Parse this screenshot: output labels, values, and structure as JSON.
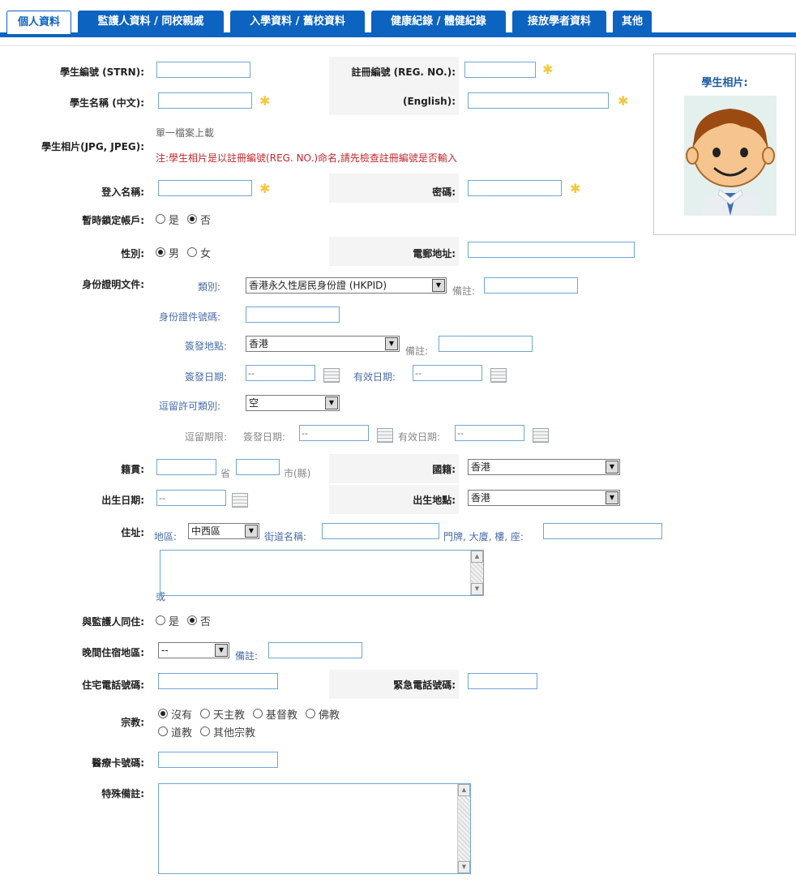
{
  "tabs": [
    {
      "label": "個人資料"
    },
    {
      "label": "監護人資料 / 同校親戚"
    },
    {
      "label": "入學資料 / 舊校資料"
    },
    {
      "label": "健康紀錄 / 體健紀錄"
    },
    {
      "label": "接放學者資料"
    },
    {
      "label": "其他"
    }
  ],
  "photo": {
    "title": "學生相片:"
  },
  "labels": {
    "strn": "學生編號 (STRN):",
    "reg_no": "註冊編號 (REG. NO.):",
    "name_zh": "學生名稱 (中文):",
    "name_en": "(English):",
    "photo_file": "學生相片(JPG, JPEG):",
    "login": "登入名稱:",
    "password": "密碼:",
    "lock": "暫時鎖定帳戶:",
    "gender": "性別:",
    "email": "電郵地址:",
    "id_doc": "身份證明文件:",
    "native": "籍貫:",
    "nationality": "國籍:",
    "dob": "出生日期:",
    "birthplace": "出生地點:",
    "address": "住址:",
    "live_guardian": "與監護人同住:",
    "night_area": "晚間住宿地區:",
    "home_phone": "住宅電話號碼:",
    "emergency_phone": "緊急電話號碼:",
    "religion": "宗教:",
    "medical_card": "醫療卡號碼:",
    "special_remark": "特殊備註:"
  },
  "photo_upload": {
    "hint": "單一檔案上載",
    "note": "注:學生相片是以註冊編號(REG. NO.)命名,請先檢查註冊編號是否輸入"
  },
  "lock_options": [
    "是",
    "否"
  ],
  "gender_options": [
    "男",
    "女"
  ],
  "id": {
    "type_label": "類別:",
    "type_value": "香港永久性居民身份證 (HKPID)",
    "remark_label": "備註:",
    "number_label": "身份證件號碼:",
    "issue_place_label": "簽發地點:",
    "issue_place_value": "香港",
    "issue_date_label": "簽發日期:",
    "issue_date_value": "--",
    "expiry_label": "有效日期:",
    "expiry_value": "--",
    "permit_label": "逗留許可類別:",
    "permit_value": "空",
    "stay_label": "逗留期限:",
    "stay_issue_label": "簽發日期:",
    "stay_issue_value": "--",
    "stay_expiry_label": "有效日期:",
    "stay_expiry_value": "--"
  },
  "native": {
    "province": "省",
    "city": "市(縣)"
  },
  "nationality_value": "香港",
  "dob_value": "--",
  "birthplace_value": "香港",
  "address": {
    "district_label": "地區:",
    "district_value": "中西區",
    "street_label": "街道名稱:",
    "number_label": "門牌, 大廈, 樓, 座:",
    "or_label": "或"
  },
  "live_guardian_options": [
    "是",
    "否"
  ],
  "night_area": {
    "value": "--",
    "remark_label": "備註:"
  },
  "religion_options": [
    "沒有",
    "天主教",
    "基督教",
    "佛教",
    "道教",
    "其他宗教"
  ],
  "required_mark": "✱",
  "colors": {
    "tab_blue": "#0c63c0",
    "accent_blue": "#4a6da8",
    "required": "#f6c83b",
    "note_red": "#c2272d"
  }
}
